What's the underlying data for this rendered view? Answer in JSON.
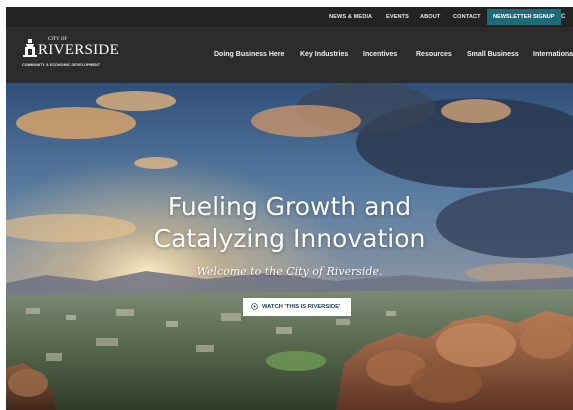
{
  "utility_nav": {
    "items": [
      "NEWS & MEDIA",
      "EVENTS",
      "ABOUT",
      "CONTACT"
    ],
    "cta": "NEWSLETTER SIGNUP"
  },
  "logo": {
    "city_of": "CITY OF",
    "name": "RIVERSIDE",
    "subtitle": "COMMUNITY & ECONOMIC DEVELOPMENT"
  },
  "main_nav": {
    "items": [
      "Doing Business Here",
      "Key Industries",
      "Incentives",
      "Resources",
      "Small Business",
      "International"
    ]
  },
  "hero": {
    "headline_line1": "Fueling Growth and",
    "headline_line2": "Catalyzing Innovation",
    "tagline": "Welcome to the City of Riverside.",
    "video_button": "WATCH 'THIS IS RIVERSIDE'"
  },
  "icons": {
    "logo_mark": "tower-icon",
    "video_button": "play-circle-icon"
  },
  "colors": {
    "utility_bar": "#232323",
    "header": "#2c2c2c",
    "newsletter_cta": "#1f6a78",
    "video_button_text": "#1f3a52"
  }
}
